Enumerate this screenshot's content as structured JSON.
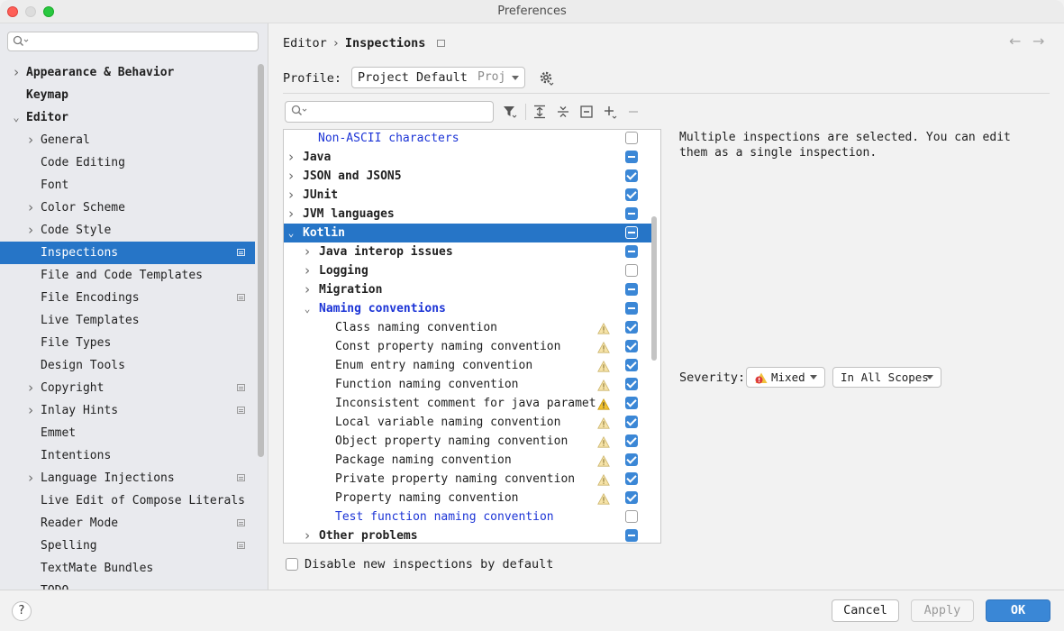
{
  "window": {
    "title": "Preferences"
  },
  "sidebar": {
    "search_placeholder": "",
    "items": [
      {
        "label": "Appearance & Behavior",
        "bold": true,
        "expandable": true,
        "expanded": false,
        "indent": 0
      },
      {
        "label": "Keymap",
        "bold": true,
        "expandable": false,
        "indent": 0
      },
      {
        "label": "Editor",
        "bold": true,
        "expandable": true,
        "expanded": true,
        "indent": 0
      },
      {
        "label": "General",
        "expandable": true,
        "expanded": false,
        "indent": 1
      },
      {
        "label": "Code Editing",
        "indent": 1
      },
      {
        "label": "Font",
        "indent": 1
      },
      {
        "label": "Color Scheme",
        "expandable": true,
        "expanded": false,
        "indent": 1
      },
      {
        "label": "Code Style",
        "expandable": true,
        "expanded": false,
        "indent": 1
      },
      {
        "label": "Inspections",
        "indent": 1,
        "selected": true,
        "project_icon": true
      },
      {
        "label": "File and Code Templates",
        "indent": 1
      },
      {
        "label": "File Encodings",
        "indent": 1,
        "project_icon": true
      },
      {
        "label": "Live Templates",
        "indent": 1
      },
      {
        "label": "File Types",
        "indent": 1
      },
      {
        "label": "Design Tools",
        "indent": 1
      },
      {
        "label": "Copyright",
        "expandable": true,
        "expanded": false,
        "indent": 1,
        "project_icon": true
      },
      {
        "label": "Inlay Hints",
        "expandable": true,
        "expanded": false,
        "indent": 1,
        "project_icon": true
      },
      {
        "label": "Emmet",
        "indent": 1
      },
      {
        "label": "Intentions",
        "indent": 1
      },
      {
        "label": "Language Injections",
        "expandable": true,
        "expanded": false,
        "indent": 1,
        "project_icon": true
      },
      {
        "label": "Live Edit of Compose Literals",
        "indent": 1
      },
      {
        "label": "Reader Mode",
        "indent": 1,
        "project_icon": true
      },
      {
        "label": "Spelling",
        "indent": 1,
        "project_icon": true
      },
      {
        "label": "TextMate Bundles",
        "indent": 1
      },
      {
        "label": "TODO",
        "indent": 1
      }
    ]
  },
  "breadcrumb": {
    "parent": "Editor",
    "separator": "›",
    "current": "Inspections"
  },
  "profile": {
    "label": "Profile:",
    "value": "Project Default",
    "scope_hint": "Proj"
  },
  "filter": {
    "placeholder": ""
  },
  "inspections": [
    {
      "label": "Non-ASCII characters",
      "level": 1,
      "style": "blue",
      "check": "off"
    },
    {
      "label": "Java",
      "level": 0,
      "bold": true,
      "expandable": true,
      "expanded": false,
      "check": "mix"
    },
    {
      "label": "JSON and JSON5",
      "level": 0,
      "bold": true,
      "expandable": true,
      "expanded": false,
      "check": "on"
    },
    {
      "label": "JUnit",
      "level": 0,
      "bold": true,
      "expandable": true,
      "expanded": false,
      "check": "on"
    },
    {
      "label": "JVM languages",
      "level": 0,
      "bold": true,
      "expandable": true,
      "expanded": false,
      "check": "mix"
    },
    {
      "label": "Kotlin",
      "level": 0,
      "bold": true,
      "expandable": true,
      "expanded": true,
      "check": "mix",
      "selected": true
    },
    {
      "label": "Java interop issues",
      "level": 1,
      "bold": true,
      "expandable": true,
      "expanded": false,
      "check": "mix"
    },
    {
      "label": "Logging",
      "level": 1,
      "bold": true,
      "expandable": true,
      "expanded": false,
      "check": "off"
    },
    {
      "label": "Migration",
      "level": 1,
      "bold": true,
      "expandable": true,
      "expanded": false,
      "check": "mix"
    },
    {
      "label": "Naming conventions",
      "level": 1,
      "bold": true,
      "style": "blue",
      "expandable": true,
      "expanded": true,
      "check": "mix"
    },
    {
      "label": "Class naming convention",
      "level": 2,
      "warn": true,
      "check": "on"
    },
    {
      "label": "Const property naming convention",
      "level": 2,
      "warn": true,
      "check": "on"
    },
    {
      "label": "Enum entry naming convention",
      "level": 2,
      "warn": true,
      "check": "on"
    },
    {
      "label": "Function naming convention",
      "level": 2,
      "warn": true,
      "check": "on"
    },
    {
      "label": "Inconsistent comment for java paramet",
      "level": 2,
      "warn": true,
      "warn_strong": true,
      "check": "on"
    },
    {
      "label": "Local variable naming convention",
      "level": 2,
      "warn": true,
      "check": "on"
    },
    {
      "label": "Object property naming convention",
      "level": 2,
      "warn": true,
      "check": "on"
    },
    {
      "label": "Package naming convention",
      "level": 2,
      "warn": true,
      "check": "on"
    },
    {
      "label": "Private property naming convention",
      "level": 2,
      "warn": true,
      "check": "on"
    },
    {
      "label": "Property naming convention",
      "level": 2,
      "warn": true,
      "check": "on"
    },
    {
      "label": "Test function naming convention",
      "level": 2,
      "style": "blue",
      "check": "off"
    },
    {
      "label": "Other problems",
      "level": 1,
      "bold": true,
      "expandable": true,
      "expanded": false,
      "check": "mix"
    }
  ],
  "description": "Multiple inspections are selected. You can edit them as a single inspection.",
  "severity": {
    "label": "Severity:",
    "value": "Mixed",
    "scope": "In All Scopes"
  },
  "disable_new": {
    "label": "Disable new inspections by default",
    "checked": false
  },
  "buttons": {
    "help": "?",
    "cancel": "Cancel",
    "apply": "Apply",
    "ok": "OK"
  },
  "colors": {
    "selection": "#2675c7",
    "accent": "#3b87d6",
    "link_blue": "#1c34d6"
  }
}
